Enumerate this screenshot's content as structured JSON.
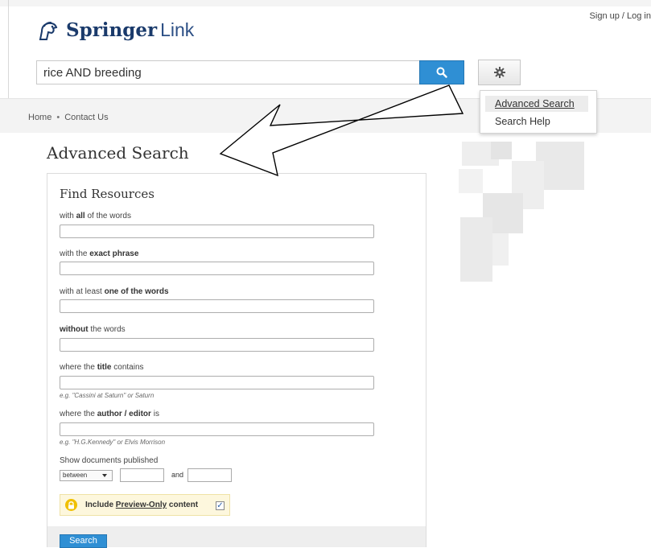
{
  "header": {
    "signup_label": "Sign up / Log in",
    "brand_bold": "Springer",
    "brand_rest": "Link",
    "search_query": "rice AND breeding"
  },
  "breadcrumb": {
    "home": "Home",
    "separator": "•",
    "contact": "Contact Us"
  },
  "settings_menu": {
    "items": [
      "Advanced Search",
      "Search Help"
    ],
    "active_index": 0
  },
  "page": {
    "title": "Advanced Search"
  },
  "form": {
    "section_title": "Find Resources",
    "fields": [
      {
        "pre": "with ",
        "bold": "all",
        "post": " of the words",
        "value": ""
      },
      {
        "pre": "with the ",
        "bold": "exact phrase",
        "post": "",
        "value": ""
      },
      {
        "pre": "with at least ",
        "bold": "one of the words",
        "post": "",
        "value": ""
      },
      {
        "pre": "",
        "bold": "without",
        "post": " the words",
        "value": ""
      },
      {
        "pre": "where the ",
        "bold": "title",
        "post": " contains",
        "value": "",
        "hint": "e.g. \"Cassini at Saturn\" or Saturn"
      },
      {
        "pre": "where the ",
        "bold": "author / editor",
        "post": " is",
        "value": "",
        "hint": "e.g. \"H.G.Kennedy\" or Elvis Morrison"
      }
    ],
    "date": {
      "label": "Show documents published",
      "selected": "between",
      "and_label": "and",
      "start": "",
      "end": ""
    },
    "preview": {
      "pre": "Include ",
      "link": "Preview-Only",
      "post": " content",
      "checked": true
    },
    "submit_label": "Search"
  },
  "colors": {
    "brand": "#1a3a6b",
    "accent": "#2f8fd4",
    "preview_bg": "#fdf7dd",
    "lock": "#f0c000"
  },
  "icons": [
    "springer-horse-logo-icon",
    "search-icon",
    "gear-icon",
    "lock-icon",
    "checkmark-icon",
    "arrow-annotation-icon"
  ]
}
